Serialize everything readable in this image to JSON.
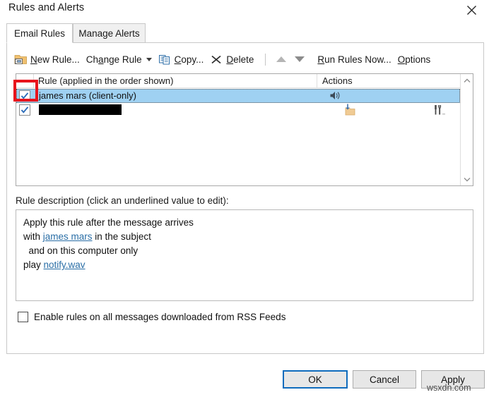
{
  "window": {
    "title": "Rules and Alerts",
    "close_icon": "close-x-icon"
  },
  "tabs": [
    {
      "label": "Email Rules",
      "active": true
    },
    {
      "label": "Manage Alerts",
      "active": false
    }
  ],
  "toolbar": {
    "new_rule": {
      "label_pre": "N",
      "label_post": "ew Rule...",
      "icon": "new-rule-folder-icon"
    },
    "change_rule": {
      "label_pre": "Ch",
      "label_mid": "a",
      "label_post": "nge Rule",
      "icon": "chevron-down-icon"
    },
    "copy": {
      "label_pre": "C",
      "label_post": "opy...",
      "icon": "copy-pages-icon"
    },
    "delete": {
      "label_pre": "D",
      "label_post": "elete",
      "icon": "delete-x-icon"
    },
    "move_up": {
      "icon": "arrow-up-icon"
    },
    "move_down": {
      "icon": "arrow-down-icon"
    },
    "run_rules_now": {
      "label_pre": "R",
      "label_post": "un Rules Now..."
    },
    "options": {
      "label_pre": "O",
      "label_post": "ptions"
    }
  },
  "rules_list": {
    "columns": {
      "rule": "Rule (applied in the order shown)",
      "actions": "Actions"
    },
    "rows": [
      {
        "checked": true,
        "label": "james mars  (client-only)",
        "redacted": false,
        "selected": true,
        "action_icons": [
          "speaker-icon"
        ]
      },
      {
        "checked": true,
        "label": "",
        "redacted": true,
        "selected": false,
        "action_icons": [
          "move-to-folder-icon",
          "tools-icon"
        ]
      }
    ],
    "scrollbar": {
      "up_icon": "chevron-up-icon",
      "down_icon": "chevron-down-icon"
    }
  },
  "description": {
    "title": "Rule description (click an underlined value to edit):",
    "lines": [
      {
        "prefix": "Apply this rule after the message arrives",
        "link": "",
        "suffix": ""
      },
      {
        "prefix": "with ",
        "link": "james mars",
        "suffix": " in the subject"
      },
      {
        "prefix": "  and on this computer only",
        "link": "",
        "suffix": ""
      },
      {
        "prefix": "play ",
        "link": "notify.wav",
        "suffix": ""
      }
    ]
  },
  "rss_option": {
    "label": "Enable rules on all messages downloaded from RSS Feeds",
    "checked": false
  },
  "footer": {
    "ok": "OK",
    "cancel": "Cancel",
    "apply": "Apply"
  },
  "annotation": {
    "color": "#e8141c",
    "target": "first-rule-checkbox"
  },
  "watermark": {
    "text": "wsxdn.com"
  },
  "colors": {
    "selection_blue": "#9fd1f2",
    "focus_blue": "#0f6cbd",
    "annotation_red": "#e8141c",
    "link_blue": "#2a6ea6"
  }
}
